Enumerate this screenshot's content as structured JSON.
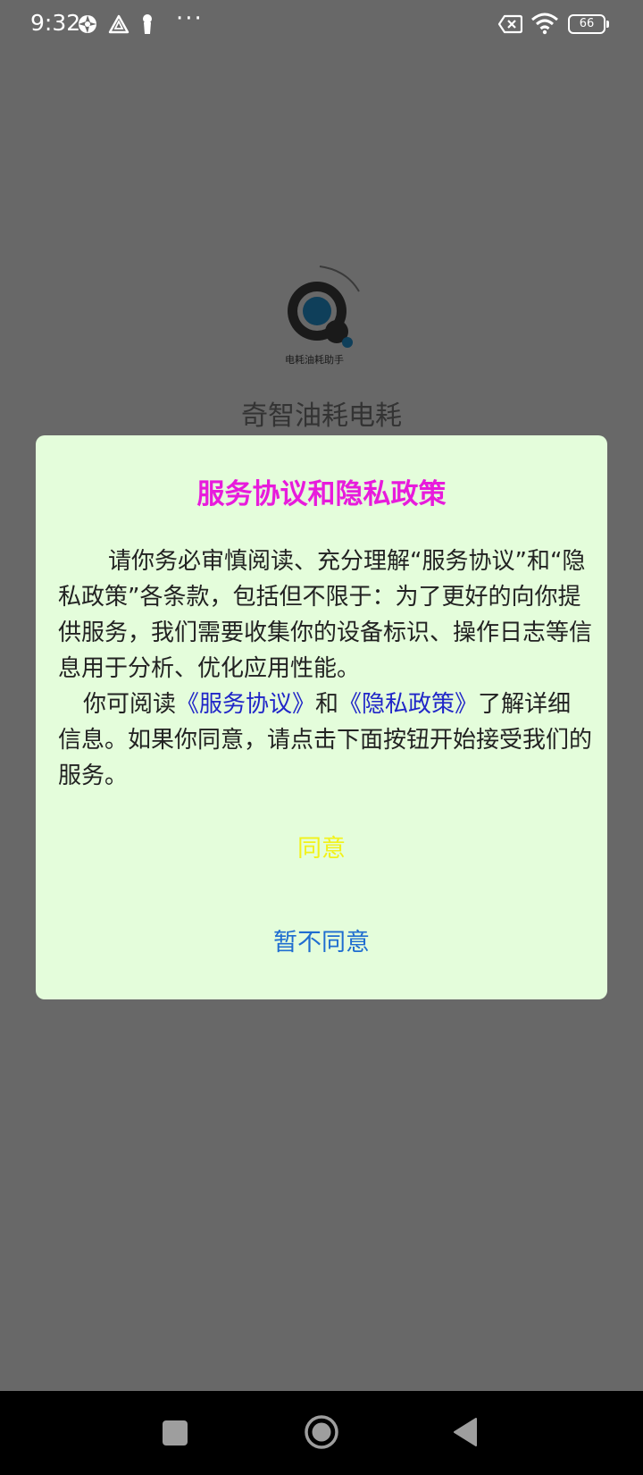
{
  "status_bar": {
    "time": "9:32",
    "icons": [
      "camera-shutter-icon",
      "warning-triangle-icon",
      "figure-icon",
      "more-dots-icon",
      "sim-error-icon",
      "wifi-icon",
      "battery-icon"
    ],
    "dots": "···",
    "battery_level": "66"
  },
  "splash": {
    "logo_caption": "电耗油耗助手",
    "app_name": "奇智油耗电耗"
  },
  "dialog": {
    "title": "服务协议和隐私政策",
    "paragraph1": "请你务必审慎阅读、充分理解“服务协议”和“隐私政策”各条款，包括但不限于：为了更好的向你提供服务，我们需要收集你的设备标识、操作日志等信息用于分析、优化应用性能。",
    "p2_prefix": "你可阅读",
    "link_service": "《服务协议》",
    "p2_and": "和",
    "link_privacy": "《隐私政策》",
    "p2_suffix": "了解详细信息。如果你同意，请点击下面按钮开始接受我们的服务。",
    "agree_label": "同意",
    "disagree_label": "暂不同意"
  },
  "navbar": {
    "items": [
      "recents-square-icon",
      "home-circle-icon",
      "back-triangle-icon"
    ]
  },
  "colors": {
    "overlay": "#686868",
    "dialog_bg": "#e4fddb",
    "title": "#e81bdc",
    "link": "#2026c8",
    "agree": "#f2f21a",
    "disagree": "#1f6dd0"
  }
}
